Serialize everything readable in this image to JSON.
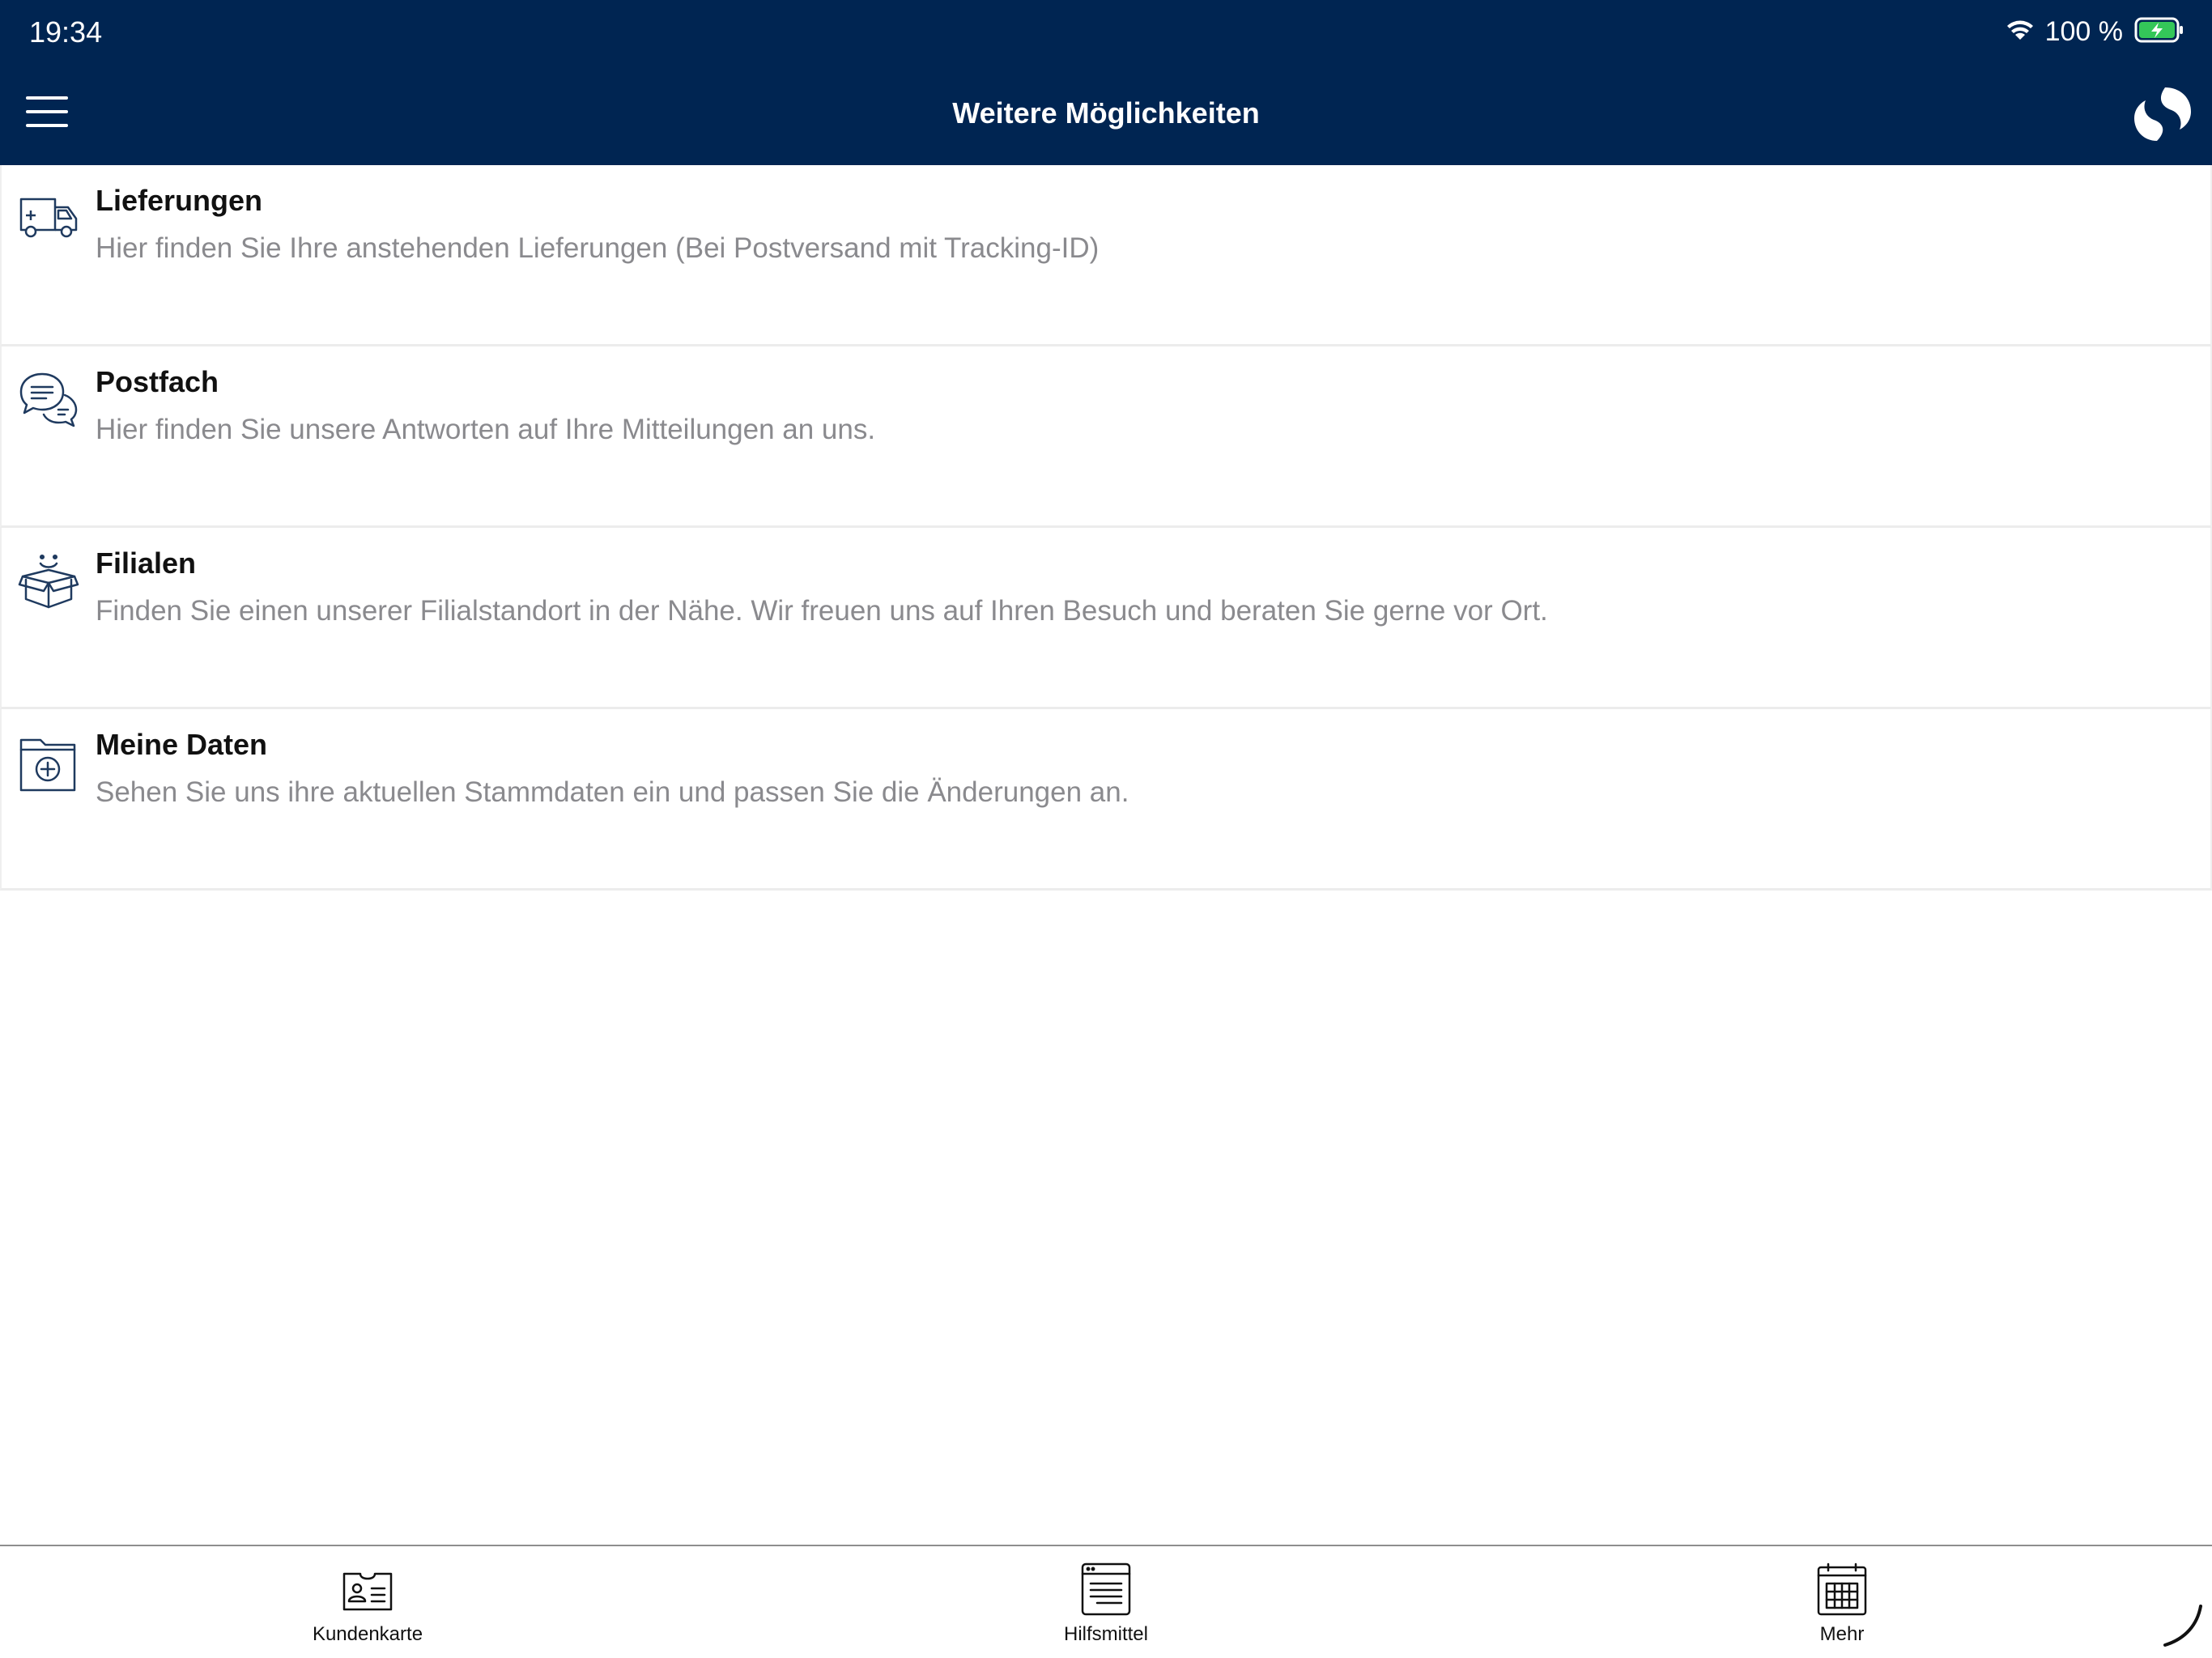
{
  "status_bar": {
    "time": "19:34",
    "battery": "100 %",
    "wifi_icon": "wifi-icon",
    "battery_icon": "battery-charging-icon"
  },
  "header": {
    "title": "Weitere Möglichkeiten",
    "menu_icon": "hamburger-menu-icon",
    "logo_icon": "brand-logo-icon"
  },
  "list": {
    "items": [
      {
        "title": "Lieferungen",
        "description": "Hier finden Sie Ihre anstehenden Lieferungen (Bei Postversand mit Tracking-ID)",
        "icon": "delivery-van-icon"
      },
      {
        "title": "Postfach",
        "description": "Hier finden Sie unsere Antworten auf Ihre Mitteilungen an uns.",
        "icon": "chat-bubbles-icon"
      },
      {
        "title": "Filialen",
        "description": "Finden Sie einen unserer Filialstandort in der Nähe. Wir freuen uns auf Ihren Besuch und beraten Sie gerne vor Ort.",
        "icon": "smiling-box-icon"
      },
      {
        "title": "Meine Daten",
        "description": "Sehen Sie uns ihre aktuellen Stammdaten ein und passen Sie die Änderungen an.",
        "icon": "folder-plus-icon"
      }
    ]
  },
  "tabbar": {
    "tabs": [
      {
        "label": "Kundenkarte",
        "icon": "customer-card-icon"
      },
      {
        "label": "Hilfsmittel",
        "icon": "document-window-icon"
      },
      {
        "label": "Mehr",
        "icon": "calendar-grid-icon"
      }
    ]
  },
  "colors": {
    "header_bg": "#002552",
    "icon_stroke": "#1f3a5f",
    "description_text": "#8a8a8e",
    "battery_fill": "#34c759"
  }
}
